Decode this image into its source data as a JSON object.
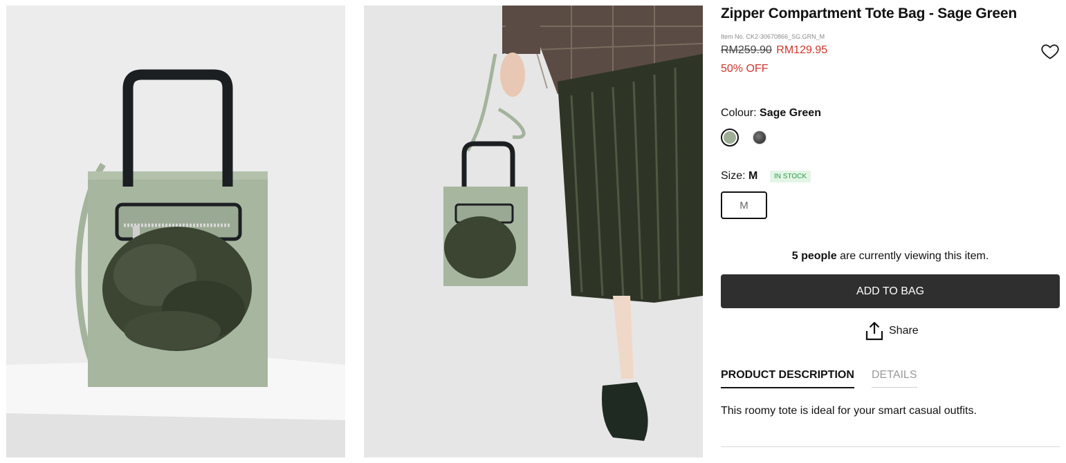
{
  "gallery": {
    "image1_alt": "",
    "image2_alt": ""
  },
  "product": {
    "title": "Zipper Compartment Tote Bag - Sage Green",
    "item_no": "Item No. CK2-30670866_SG.GRN_M",
    "old_price": "RM259.90",
    "new_price": "RM129.95",
    "discount": "50% OFF",
    "colour_label": "Colour:",
    "colour_value": "Sage Green",
    "size_label": "Size:",
    "size_value": "M",
    "stock_badge": "IN STOCK",
    "size_option": "M",
    "viewing_count": "5 people",
    "viewing_text": " are currently viewing this item.",
    "add_to_bag": "ADD TO BAG",
    "share": "Share",
    "tabs": [
      "PRODUCT DESCRIPTION",
      "DETAILS"
    ],
    "description": "This roomy tote is ideal for your smart casual outfits."
  },
  "colors": {
    "price_red": "#d0342c",
    "button_bg": "#2f2f2f",
    "stock_green": "#2e9b4a",
    "swatch_sage": "#9fae96",
    "swatch_dark": "#4a4a4a"
  },
  "icons": [
    "heart-icon",
    "share-upload-icon"
  ]
}
